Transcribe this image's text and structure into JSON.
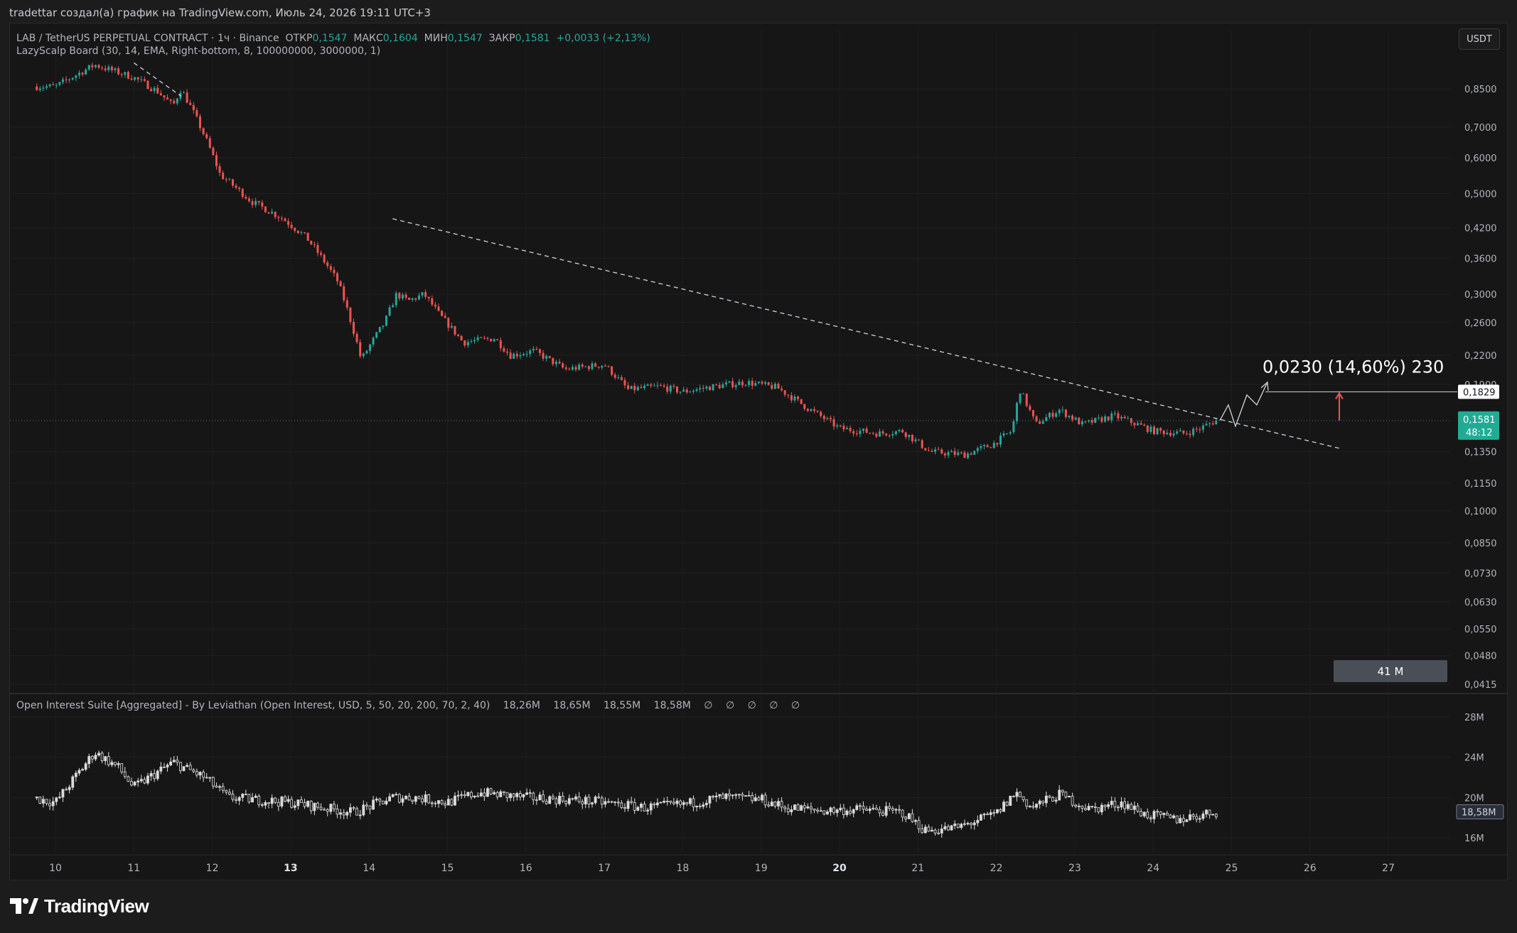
{
  "header": {
    "author_line": "tradettar создал(а) график на TradingView.com, Июль 24, 2026 19:11 UTC+3"
  },
  "legend": {
    "symbol": "LAB / TetherUS PERPETUAL CONTRACT · 1ч · Binance",
    "open_label": "ОТКР",
    "open_value": "0,1547",
    "high_label": "МАКС",
    "high_value": "0,1604",
    "low_label": "МИН",
    "low_value": "0,1547",
    "close_label": "ЗАКР",
    "close_value": "0,1581",
    "change": "+0,0033 (+2,13%)",
    "indicator": "LazyScalp Board (30, 14, EMA, Right-bottom, 8, 100000000, 3000000, 1)"
  },
  "toolbar": {
    "currency_button": "USDT"
  },
  "price_axis": {
    "ticks": [
      "0,8500",
      "0,7000",
      "0,6000",
      "0,5000",
      "0,4200",
      "0,3600",
      "0,3000",
      "0,2600",
      "0,2200",
      "0,1900",
      "0,1350",
      "0,1150",
      "0,1000",
      "0,0850",
      "0,0730",
      "0,0630",
      "0,0550",
      "0,0480",
      "0,0415"
    ],
    "target_label": "0,1829",
    "current_price": "0,1581",
    "countdown": "48:12"
  },
  "annotation": {
    "measure_text": "0,0230 (14,60%) 230",
    "volume_box": "41 M"
  },
  "oi_pane": {
    "title": "Open Interest Suite [Aggregated] - By Leviathan (Open Interest, USD, 5, 50, 20, 200, 70, 2, 40)",
    "values": [
      "18,26M",
      "18,65M",
      "18,55M",
      "18,58M",
      "∅",
      "∅",
      "∅",
      "∅",
      "∅"
    ],
    "axis_ticks": [
      "28M",
      "24M",
      "20M",
      "16M"
    ],
    "current_label": "18,58M"
  },
  "time_axis": {
    "labels": [
      "10",
      "11",
      "12",
      "13",
      "14",
      "15",
      "16",
      "17",
      "18",
      "19",
      "20",
      "21",
      "22",
      "23",
      "24",
      "25",
      "26",
      "27"
    ],
    "bold": [
      "13",
      "20"
    ]
  },
  "colors": {
    "up": "#26a69a",
    "down": "#ef5350",
    "price_tag": "#22ab94"
  },
  "footer": {
    "brand": "TradingView"
  },
  "chart_data": {
    "type": "candlestick",
    "symbol": "LAB / TetherUS PERPETUAL CONTRACT",
    "interval": "1h",
    "ohlc_last": {
      "open": 0.1547,
      "high": 0.1604,
      "low": 0.1547,
      "close": 0.1581
    },
    "y_scale": "log",
    "y_range": [
      0.0415,
      0.96
    ],
    "x_categories": [
      "10",
      "11",
      "12",
      "13",
      "14",
      "15",
      "16",
      "17",
      "18",
      "19",
      "20",
      "21",
      "22",
      "23",
      "24",
      "25",
      "26",
      "27"
    ],
    "close_anchors": [
      {
        "day": 10.0,
        "price": 0.86
      },
      {
        "day": 10.5,
        "price": 0.96
      },
      {
        "day": 11.0,
        "price": 0.9
      },
      {
        "day": 11.3,
        "price": 0.84
      },
      {
        "day": 11.5,
        "price": 0.78
      },
      {
        "day": 11.6,
        "price": 0.85
      },
      {
        "day": 11.85,
        "price": 0.7
      },
      {
        "day": 12.1,
        "price": 0.55
      },
      {
        "day": 12.5,
        "price": 0.48
      },
      {
        "day": 12.9,
        "price": 0.44
      },
      {
        "day": 13.2,
        "price": 0.4
      },
      {
        "day": 13.6,
        "price": 0.32
      },
      {
        "day": 13.9,
        "price": 0.215
      },
      {
        "day": 14.2,
        "price": 0.26
      },
      {
        "day": 14.35,
        "price": 0.3
      },
      {
        "day": 14.5,
        "price": 0.29
      },
      {
        "day": 14.7,
        "price": 0.3
      },
      {
        "day": 14.9,
        "price": 0.27
      },
      {
        "day": 15.2,
        "price": 0.235
      },
      {
        "day": 15.6,
        "price": 0.24
      },
      {
        "day": 15.8,
        "price": 0.22
      },
      {
        "day": 16.1,
        "price": 0.225
      },
      {
        "day": 16.5,
        "price": 0.205
      },
      {
        "day": 17.0,
        "price": 0.21
      },
      {
        "day": 17.3,
        "price": 0.185
      },
      {
        "day": 17.7,
        "price": 0.188
      },
      {
        "day": 18.0,
        "price": 0.183
      },
      {
        "day": 18.4,
        "price": 0.188
      },
      {
        "day": 18.8,
        "price": 0.192
      },
      {
        "day": 19.2,
        "price": 0.187
      },
      {
        "day": 19.6,
        "price": 0.168
      },
      {
        "day": 20.0,
        "price": 0.152
      },
      {
        "day": 20.5,
        "price": 0.148
      },
      {
        "day": 20.8,
        "price": 0.15
      },
      {
        "day": 21.15,
        "price": 0.135
      },
      {
        "day": 21.6,
        "price": 0.133
      },
      {
        "day": 21.95,
        "price": 0.14
      },
      {
        "day": 22.2,
        "price": 0.15
      },
      {
        "day": 22.3,
        "price": 0.185
      },
      {
        "day": 22.5,
        "price": 0.155
      },
      {
        "day": 22.8,
        "price": 0.167
      },
      {
        "day": 23.1,
        "price": 0.155
      },
      {
        "day": 23.5,
        "price": 0.162
      },
      {
        "day": 23.8,
        "price": 0.155
      },
      {
        "day": 24.0,
        "price": 0.15
      },
      {
        "day": 24.4,
        "price": 0.148
      },
      {
        "day": 24.6,
        "price": 0.152
      },
      {
        "day": 24.8,
        "price": 0.1581
      }
    ],
    "trendlines": [
      {
        "from": {
          "day": 14.3,
          "price": 0.44
        },
        "to": {
          "day": 26.4,
          "price": 0.137
        }
      },
      {
        "from": {
          "day": 11.0,
          "price": 0.97
        },
        "to": {
          "day": 11.6,
          "price": 0.82
        }
      }
    ],
    "target": {
      "price": 0.1829,
      "change": 0.023,
      "change_pct": "14,60%",
      "ticks": 230
    },
    "open_interest": {
      "unit": "M USD",
      "y_range": [
        15,
        29
      ],
      "anchors": [
        {
          "day": 9.7,
          "oi": 20.0
        },
        {
          "day": 10.0,
          "oi": 19.5
        },
        {
          "day": 10.5,
          "oi": 24.5
        },
        {
          "day": 10.8,
          "oi": 23.0
        },
        {
          "day": 11.0,
          "oi": 21.0
        },
        {
          "day": 11.5,
          "oi": 23.5
        },
        {
          "day": 11.9,
          "oi": 22.0
        },
        {
          "day": 12.2,
          "oi": 20.0
        },
        {
          "day": 13.0,
          "oi": 19.5
        },
        {
          "day": 13.8,
          "oi": 18.5
        },
        {
          "day": 14.3,
          "oi": 20.0
        },
        {
          "day": 14.6,
          "oi": 20.0
        },
        {
          "day": 15.0,
          "oi": 19.5
        },
        {
          "day": 15.4,
          "oi": 20.5
        },
        {
          "day": 16.0,
          "oi": 20.0
        },
        {
          "day": 16.5,
          "oi": 19.8
        },
        {
          "day": 17.0,
          "oi": 19.5
        },
        {
          "day": 17.5,
          "oi": 19.0
        },
        {
          "day": 18.0,
          "oi": 19.3
        },
        {
          "day": 18.5,
          "oi": 20.0
        },
        {
          "day": 19.0,
          "oi": 19.8
        },
        {
          "day": 19.3,
          "oi": 19.0
        },
        {
          "day": 19.8,
          "oi": 18.7
        },
        {
          "day": 20.3,
          "oi": 18.8
        },
        {
          "day": 20.8,
          "oi": 18.5
        },
        {
          "day": 21.1,
          "oi": 16.7
        },
        {
          "day": 21.5,
          "oi": 17.0
        },
        {
          "day": 22.0,
          "oi": 18.4
        },
        {
          "day": 22.25,
          "oi": 20.5
        },
        {
          "day": 22.45,
          "oi": 19.0
        },
        {
          "day": 22.8,
          "oi": 20.3
        },
        {
          "day": 23.2,
          "oi": 18.8
        },
        {
          "day": 23.6,
          "oi": 19.5
        },
        {
          "day": 23.9,
          "oi": 18.3
        },
        {
          "day": 24.3,
          "oi": 17.8
        },
        {
          "day": 24.8,
          "oi": 18.58
        }
      ]
    }
  }
}
